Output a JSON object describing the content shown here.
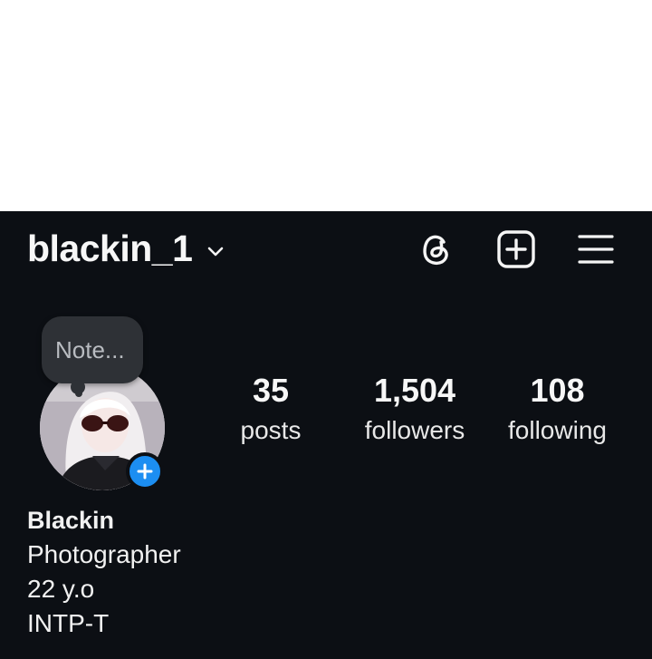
{
  "header": {
    "username": "blackin_1",
    "icons": {
      "switch": "chevron-down-icon",
      "threads": "threads-icon",
      "create": "plus-square-icon",
      "menu": "hamburger-menu-icon"
    }
  },
  "note": {
    "placeholder": "Note..."
  },
  "avatar": {
    "badge_icon": "plus-icon"
  },
  "stats": {
    "posts": {
      "value": "35",
      "label": "posts"
    },
    "followers": {
      "value": "1,504",
      "label": "followers"
    },
    "following": {
      "value": "108",
      "label": "following"
    }
  },
  "bio": {
    "name": "Blackin",
    "lines": [
      "Photographer",
      "22 y.o",
      "INTP-T"
    ]
  },
  "colors": {
    "background": "#0c0f14",
    "accent": "#1c8ef2",
    "note_bubble": "#2e3136"
  }
}
